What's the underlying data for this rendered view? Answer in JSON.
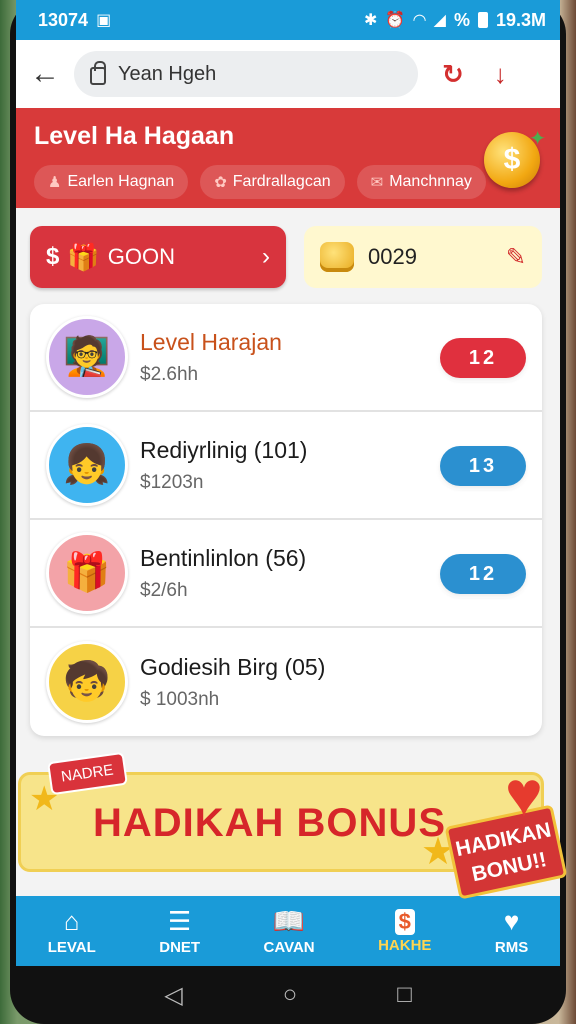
{
  "status": {
    "time": "13074",
    "right": "19.3M",
    "percent": "%"
  },
  "url": {
    "text": "Yean Hgeh"
  },
  "header": {
    "title": "Level Ha Hagaan",
    "chips": [
      {
        "label": "Earlen Hagnan",
        "icon": "person-icon"
      },
      {
        "label": "Fardrallagcan",
        "icon": "flower-icon"
      },
      {
        "label": "Manchnnay",
        "icon": "mail-icon"
      }
    ]
  },
  "actions": {
    "go_label": "GOON",
    "coins": "0029"
  },
  "list": [
    {
      "title": "Level Harajan",
      "sub": "$2.6hh",
      "badge": "12",
      "color": "red"
    },
    {
      "title": "Rediyrlinig (101)",
      "sub": "$1203n",
      "badge": "13",
      "color": "blue"
    },
    {
      "title": "Bentinlinlon (56)",
      "sub": "$2/6h",
      "badge": "12",
      "color": "blue"
    },
    {
      "title": "Godiesih Birg (05)",
      "sub": "$ 1003nh",
      "badge": "",
      "color": ""
    }
  ],
  "banner": {
    "title": "HADIKAH BONUS",
    "tag_left": "NADRE",
    "tag_right": "HADIKAN BONU!!"
  },
  "nav": [
    {
      "label": "LEVAL",
      "icon": "home-icon"
    },
    {
      "label": "DNET",
      "icon": "list-icon"
    },
    {
      "label": "CAVAN",
      "icon": "book-icon"
    },
    {
      "label": "HAKHE",
      "icon": "dollar-icon"
    },
    {
      "label": "RMS",
      "icon": "heart-chat-icon"
    }
  ]
}
